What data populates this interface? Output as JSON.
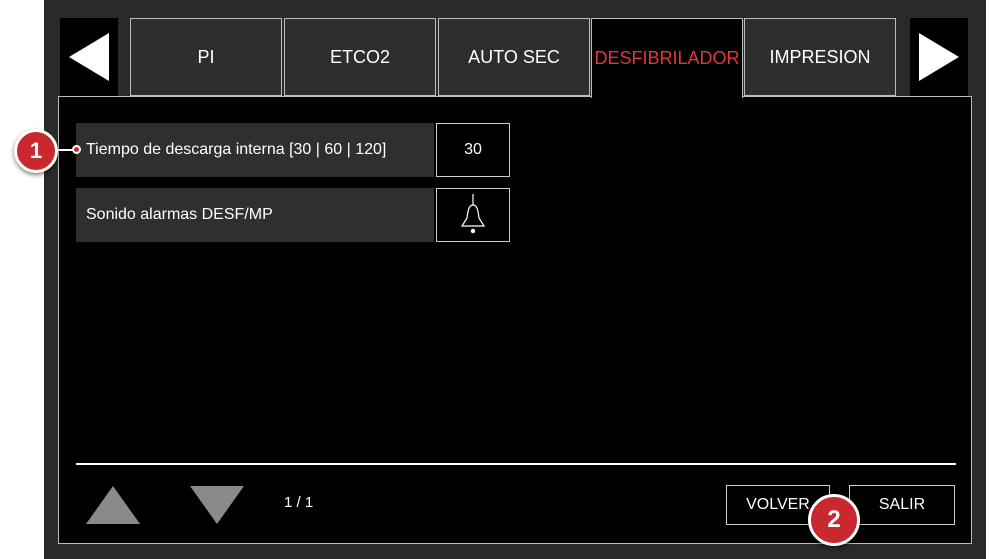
{
  "tabs": [
    {
      "label": "PI"
    },
    {
      "label": "ETCO2"
    },
    {
      "label": "AUTO SEC"
    },
    {
      "label": "DESFIBRILADOR"
    },
    {
      "label": "IMPRESION"
    }
  ],
  "active_tab": "DESFIBRILADOR",
  "settings": [
    {
      "label": "Tiempo de descarga interna [30 | 60 | 120]",
      "value": "30"
    },
    {
      "label": "Sonido alarmas DESF/MP",
      "value_icon": "bell-icon"
    }
  ],
  "footer": {
    "page_indicator": "1 / 1",
    "back_label": "VOLVER",
    "exit_label": "SALIR"
  },
  "callouts": [
    "1",
    "2"
  ],
  "colors": {
    "active_tab_text": "#e53535",
    "callout": "#c8282e",
    "background": "#000000",
    "row_bg": "#2f2f2f"
  }
}
